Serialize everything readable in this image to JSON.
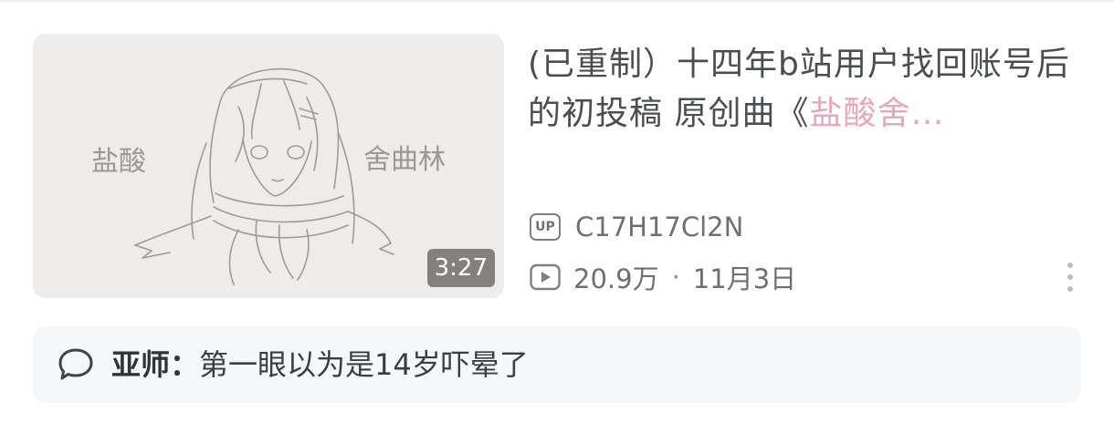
{
  "video": {
    "thumbnail_alt": "sketch of anime girl with scarf",
    "thumbnail_left_text": "盐酸",
    "thumbnail_right_text": "舍曲林",
    "duration": "3:27",
    "title_main": "(已重制）十四年b站用户找回账号后的初投稿 原创曲《",
    "title_highlight": "盐酸舍…",
    "uploader_badge": "UP",
    "uploader": "C17H17Cl2N",
    "views": "20.9万",
    "separator": "·",
    "date": "11月3日"
  },
  "comment": {
    "user": "亚师",
    "colon": "：",
    "text": "第一眼以为是14岁吓晕了"
  },
  "colors": {
    "title_text": "#4a4d52",
    "highlight_pink": "#e9a6b9",
    "meta_text": "#6c6f75",
    "comment_bg": "#f6f7f8"
  },
  "icons": {
    "views": "play-icon",
    "more": "more-vertical-icon",
    "comment": "comment-bubble-icon",
    "uploader": "up-badge-icon"
  }
}
